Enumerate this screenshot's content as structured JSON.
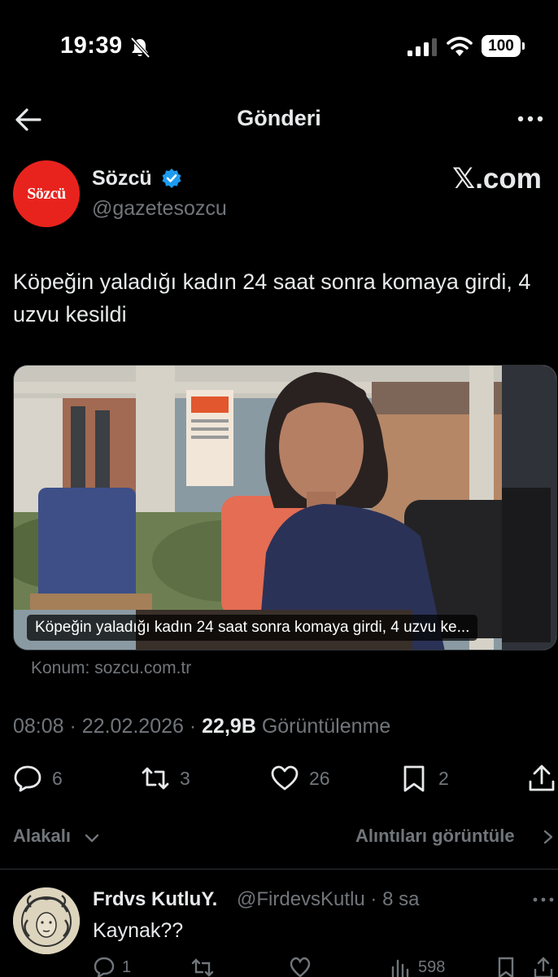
{
  "status_bar": {
    "time": "19:39",
    "battery": "100"
  },
  "header": {
    "title": "Gönderi"
  },
  "author": {
    "avatar_text": "Sözcü",
    "name": "Sözcü",
    "handle": "@gazetesozcu",
    "source": "𝕏.com"
  },
  "tweet": {
    "text": "Köpeğin yaladığı kadın 24 saat sonra komaya girdi, 4 uzvu kesildi",
    "card_caption": "Köpeğin yaladığı kadın 24 saat sonra komaya girdi, 4 uzvu ke...",
    "location": "Konum: sozcu.com.tr",
    "time": "08:08",
    "date": "22.02.2026",
    "views": "22,9B",
    "views_label": "Görüntülenme"
  },
  "actions": {
    "replies": "6",
    "reposts": "3",
    "likes": "26",
    "bookmarks": "2"
  },
  "filters": {
    "relevant": "Alakalı",
    "view_quotes": "Alıntıları görüntüle"
  },
  "reply": {
    "name": "Frdvs KutluY.",
    "handle": "@FirdevsKutlu · 8 sa",
    "text": "Kaynak??",
    "replies": "1",
    "views": "598"
  },
  "colors": {
    "accent_verified": "#1d9bf0",
    "brand_red": "#e8231d",
    "muted": "#71767b"
  }
}
